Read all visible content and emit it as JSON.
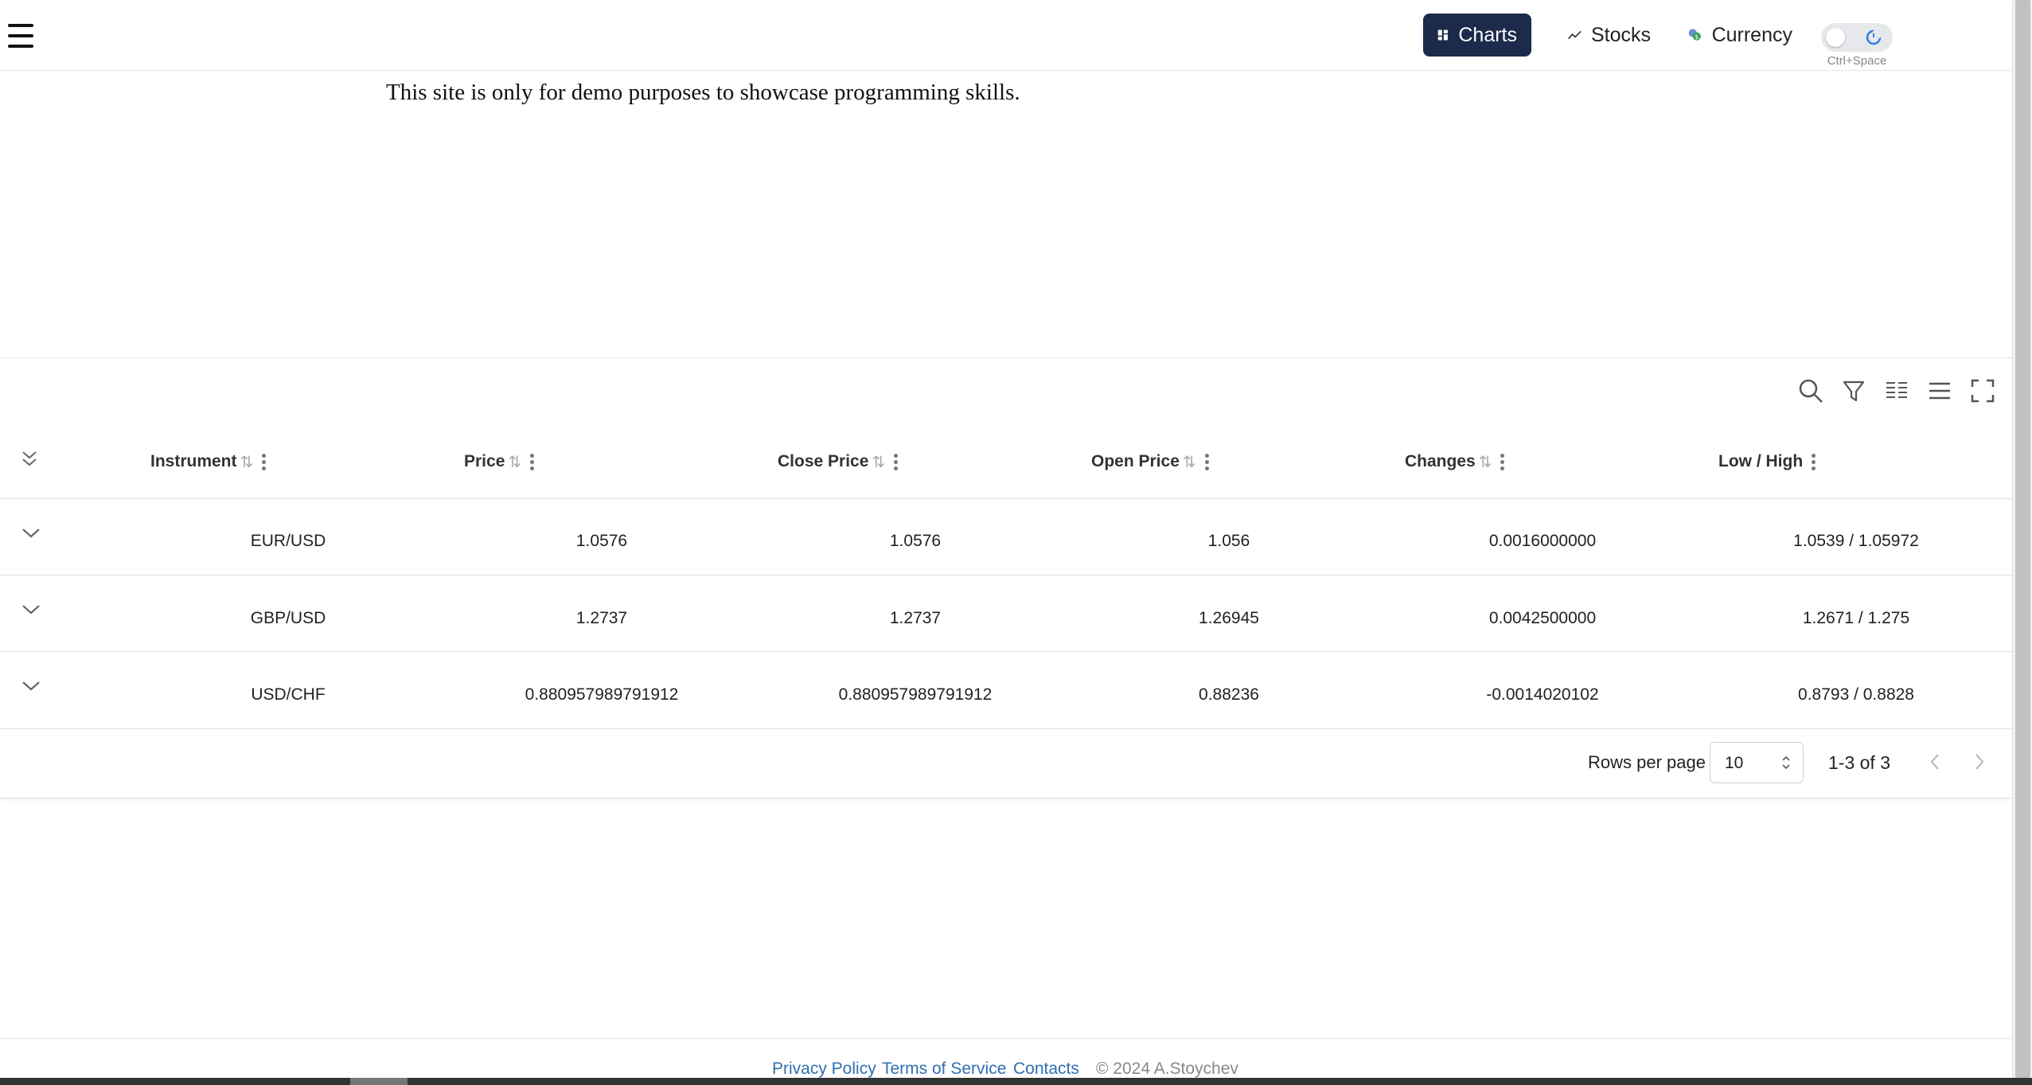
{
  "header": {
    "nav": [
      {
        "label": "Charts",
        "icon": "dashboard-icon",
        "active": true
      },
      {
        "label": "Stocks",
        "icon": "trend-line-icon",
        "active": false
      },
      {
        "label": "Currency",
        "icon": "coins-icon",
        "active": false
      }
    ],
    "theme_toggle_hint": "Ctrl+Space"
  },
  "notice": "This site is only for demo purposes to showcase programming skills.",
  "table": {
    "columns": [
      "Instrument",
      "Price",
      "Close Price",
      "Open Price",
      "Changes",
      "Low / High"
    ],
    "rows": [
      [
        "EUR/USD",
        "1.0576",
        "1.0576",
        "1.056",
        "0.0016000000",
        "1.0539 / 1.05972"
      ],
      [
        "GBP/USD",
        "1.2737",
        "1.2737",
        "1.26945",
        "0.0042500000",
        "1.2671 / 1.275"
      ],
      [
        "USD/CHF",
        "0.880957989791912",
        "0.880957989791912",
        "0.88236",
        "-0.0014020102",
        "0.8793 / 0.8828"
      ]
    ],
    "toolbar_icons": [
      "search-icon",
      "filter-icon",
      "columns-icon",
      "density-icon",
      "fullscreen-icon"
    ]
  },
  "pagination": {
    "rows_per_page_label": "Rows per page",
    "rows_per_page_value": "10",
    "range": "1-3 of 3"
  },
  "footer": {
    "links": [
      "Privacy Policy",
      "Terms of Service",
      "Contacts"
    ],
    "copyright": "© 2024 A.Stoychev"
  },
  "colors": {
    "active_nav_bg": "#1c2b4b",
    "link": "#2f6fb0"
  }
}
